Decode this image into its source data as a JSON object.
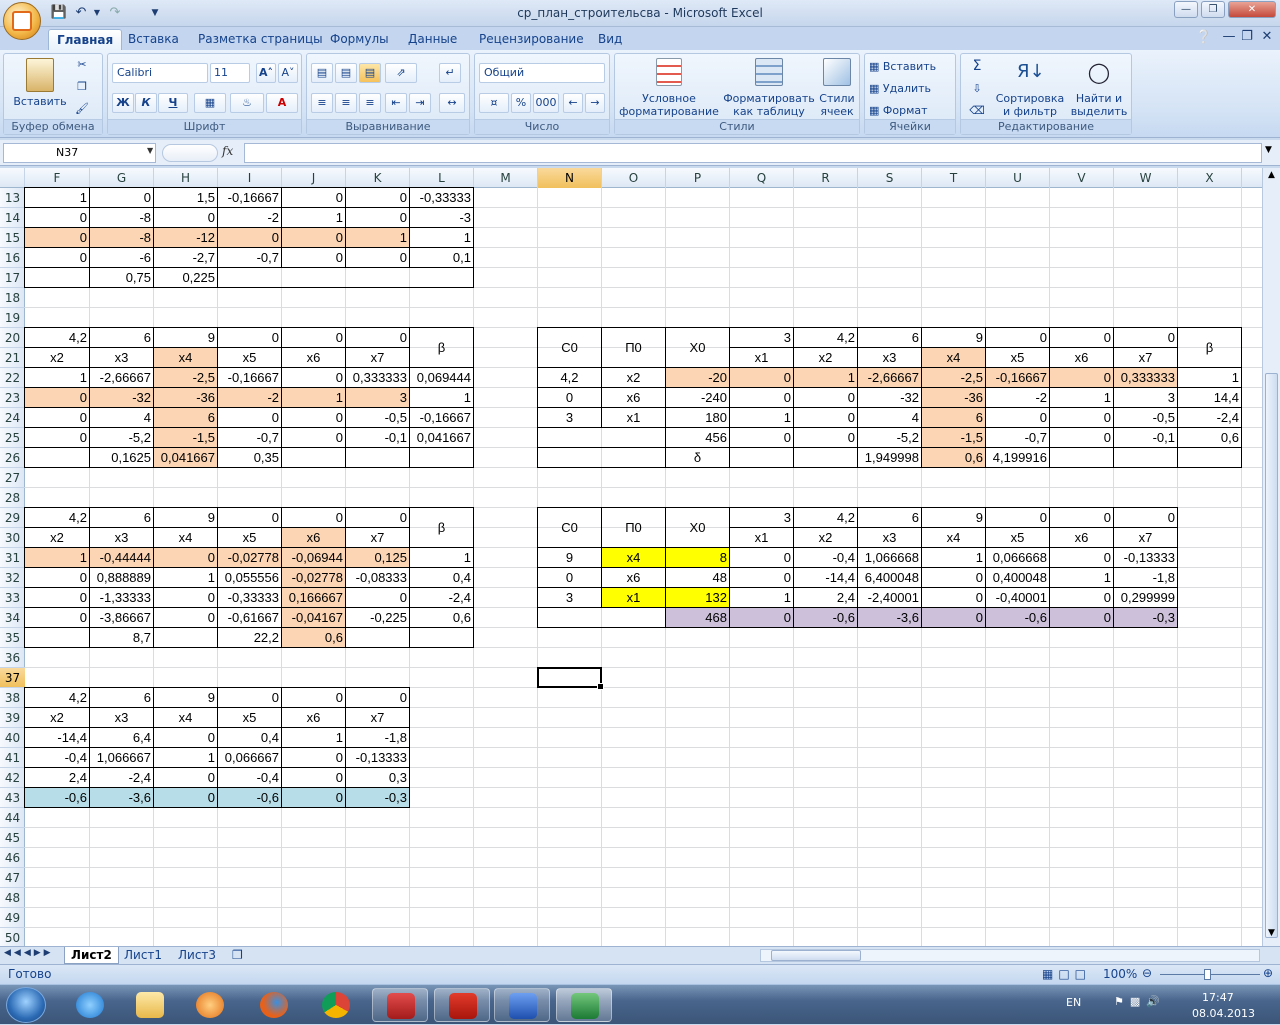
{
  "window": {
    "title": "ср_план_строительсва - Microsoft Excel"
  },
  "ribbon_tabs": [
    "Главная",
    "Вставка",
    "Разметка страницы",
    "Формулы",
    "Данные",
    "Рецензирование",
    "Вид"
  ],
  "ribbon": {
    "clipboard": {
      "paste": "Вставить",
      "label": "Буфер обмена"
    },
    "font": {
      "name": "Calibri",
      "size": "11",
      "label": "Шрифт",
      "bold": "Ж",
      "italic": "К",
      "underline": "Ч"
    },
    "alignment": {
      "label": "Выравнивание"
    },
    "number": {
      "format": "Общий",
      "label": "Число",
      "percent": "%",
      "thousands": "000"
    },
    "styles": {
      "conditional": "Условное форматирование",
      "as_table": "Форматировать как таблицу",
      "cell_styles": "Стили ячеек",
      "label": "Стили"
    },
    "cells": {
      "insert": "Вставить",
      "delete": "Удалить",
      "format": "Формат",
      "label": "Ячейки"
    },
    "editing": {
      "sort": "Сортировка и фильтр",
      "find": "Найти и выделить",
      "label": "Редактирование"
    }
  },
  "formula_bar": {
    "name_box": "N37",
    "fx": "fx",
    "formula": ""
  },
  "columns": [
    "F",
    "G",
    "H",
    "I",
    "J",
    "K",
    "L",
    "M",
    "N",
    "O",
    "P",
    "Q",
    "R",
    "S",
    "T",
    "U",
    "V",
    "W",
    "X"
  ],
  "selected_column": "N",
  "selected_row": "37",
  "rows": [
    "13",
    "14",
    "15",
    "16",
    "17",
    "18",
    "19",
    "20",
    "21",
    "22",
    "23",
    "24",
    "25",
    "26",
    "27",
    "28",
    "29",
    "30",
    "31",
    "32",
    "33",
    "34",
    "35",
    "36",
    "37",
    "38",
    "39",
    "40",
    "41",
    "42",
    "43",
    "44",
    "45",
    "46",
    "47",
    "48",
    "49",
    "50"
  ],
  "cells": {
    "r13": [
      "1",
      "0",
      "1,5",
      "-0,16667",
      "0",
      "0",
      "-0,33333"
    ],
    "r14": [
      "0",
      "-8",
      "0",
      "-2",
      "1",
      "0",
      "-3"
    ],
    "r15": [
      "0",
      "-8",
      "-12",
      "0",
      "0",
      "1",
      "1"
    ],
    "r16": [
      "0",
      "-6",
      "-2,7",
      "-0,7",
      "0",
      "0",
      "0,1"
    ],
    "r17": [
      "",
      "0,75",
      "0,225",
      "",
      "",
      "",
      ""
    ],
    "r20": [
      "4,2",
      "6",
      "9",
      "0",
      "0",
      "0",
      "β"
    ],
    "r21": [
      "x2",
      "x3",
      "x4",
      "x5",
      "x6",
      "x7"
    ],
    "r22": [
      "1",
      "-2,66667",
      "-2,5",
      "-0,16667",
      "0",
      "0,333333",
      "0,069444"
    ],
    "r23": [
      "0",
      "-32",
      "-36",
      "-2",
      "1",
      "3",
      "1"
    ],
    "r24": [
      "0",
      "4",
      "6",
      "0",
      "0",
      "-0,5",
      "-0,16667"
    ],
    "r25": [
      "0",
      "-5,2",
      "-1,5",
      "-0,7",
      "0",
      "-0,1",
      "0,041667"
    ],
    "r26": [
      "",
      "0,1625",
      "0,041667",
      "0,35",
      "",
      "",
      ""
    ],
    "r29": [
      "4,2",
      "6",
      "9",
      "0",
      "0",
      "0",
      "β"
    ],
    "r30": [
      "x2",
      "x3",
      "x4",
      "x5",
      "x6",
      "x7"
    ],
    "r31": [
      "1",
      "-0,44444",
      "0",
      "-0,02778",
      "-0,06944",
      "0,125",
      "1"
    ],
    "r32": [
      "0",
      "0,888889",
      "1",
      "0,055556",
      "-0,02778",
      "-0,08333",
      "0,4"
    ],
    "r33": [
      "0",
      "-1,33333",
      "0",
      "-0,33333",
      "0,166667",
      "0",
      "-2,4"
    ],
    "r34": [
      "0",
      "-3,86667",
      "0",
      "-0,61667",
      "-0,04167",
      "-0,225",
      "0,6"
    ],
    "r35": [
      "",
      "8,7",
      "",
      "22,2",
      "0,6",
      "",
      ""
    ],
    "r38": [
      "4,2",
      "6",
      "9",
      "0",
      "0",
      "0"
    ],
    "r39": [
      "x2",
      "x3",
      "x4",
      "x5",
      "x6",
      "x7"
    ],
    "r40": [
      "-14,4",
      "6,4",
      "0",
      "0,4",
      "1",
      "-1,8"
    ],
    "r41": [
      "-0,4",
      "1,066667",
      "1",
      "0,066667",
      "0",
      "-0,13333"
    ],
    "r42": [
      "2,4",
      "-2,4",
      "0",
      "-0,4",
      "0",
      "0,3"
    ],
    "r43": [
      "-0,6",
      "-3,6",
      "0",
      "-0,6",
      "0",
      "-0,3"
    ],
    "t1_head": [
      "C0",
      "П0",
      "X0",
      "3",
      "4,2",
      "6",
      "9",
      "0",
      "0",
      "0",
      "β"
    ],
    "t1_vars": [
      "x1",
      "x2",
      "x3",
      "x4",
      "x5",
      "x6",
      "x7"
    ],
    "t1_r22": [
      "4,2",
      "x2",
      "-20",
      "0",
      "1",
      "-2,66667",
      "-2,5",
      "-0,16667",
      "0",
      "0,333333",
      "1"
    ],
    "t1_r23": [
      "0",
      "x6",
      "-240",
      "0",
      "0",
      "-32",
      "-36",
      "-2",
      "1",
      "3",
      "14,4"
    ],
    "t1_r24": [
      "3",
      "x1",
      "180",
      "1",
      "0",
      "4",
      "6",
      "0",
      "0",
      "-0,5",
      "-2,4"
    ],
    "t1_r25": [
      "",
      "",
      "456",
      "0",
      "0",
      "-5,2",
      "-1,5",
      "-0,7",
      "0",
      "-0,1",
      "0,6"
    ],
    "t1_r26": [
      "",
      "",
      "δ",
      "",
      "",
      "1,949998",
      "0,6",
      "4,199916",
      "",
      "",
      ""
    ],
    "t2_head": [
      "C0",
      "П0",
      "X0",
      "3",
      "4,2",
      "6",
      "9",
      "0",
      "0",
      "0"
    ],
    "t2_vars": [
      "x1",
      "x2",
      "x3",
      "x4",
      "x5",
      "x6",
      "x7"
    ],
    "t2_r31": [
      "9",
      "x4",
      "8",
      "0",
      "-0,4",
      "1,066668",
      "1",
      "0,066668",
      "0",
      "-0,13333"
    ],
    "t2_r32": [
      "0",
      "x6",
      "48",
      "0",
      "-14,4",
      "6,400048",
      "0",
      "0,400048",
      "1",
      "-1,8"
    ],
    "t2_r33": [
      "3",
      "x1",
      "132",
      "1",
      "2,4",
      "-2,40001",
      "0",
      "-0,40001",
      "0",
      "0,299999"
    ],
    "t2_r34": [
      "",
      "",
      "468",
      "0",
      "-0,6",
      "-3,6",
      "0",
      "-0,6",
      "0",
      "-0,3"
    ]
  },
  "sheet_tabs": [
    "Лист2",
    "Лист1",
    "Лист3"
  ],
  "status": {
    "ready": "Готово",
    "zoom": "100%"
  },
  "taskbar": {
    "lang": "EN",
    "time": "17:47",
    "date": "08.04.2013"
  },
  "colors": {
    "peach": "#fcd5b4",
    "yellow": "#ffff00",
    "lavender": "#ccc0da",
    "lightblue": "#b7dee8"
  }
}
